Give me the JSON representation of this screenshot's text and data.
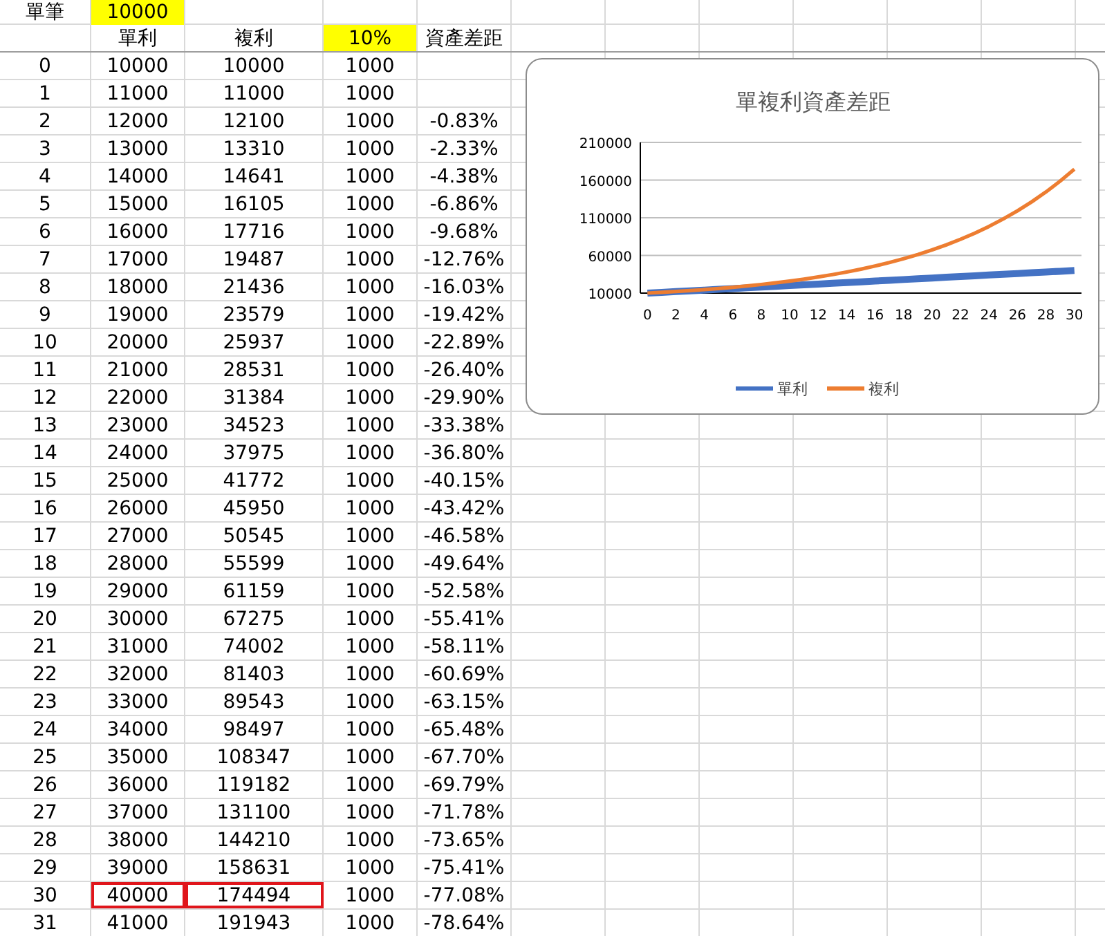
{
  "top": {
    "label": "單筆",
    "value": "10000"
  },
  "header": {
    "simple": "單利",
    "compound": "複利",
    "rate": "10%",
    "gap": "資產差距"
  },
  "rows": [
    {
      "n": "0",
      "simple": "10000",
      "compound": "10000",
      "rate": "1000",
      "outlined": false
    },
    {
      "n": "1",
      "simple": "11000",
      "compound": "11000",
      "rate": "1000",
      "outlined": false
    },
    {
      "n": "2",
      "simple": "12000",
      "compound": "12100",
      "rate": "1000",
      "gap": "-0.83%",
      "outlined": false
    },
    {
      "n": "3",
      "simple": "13000",
      "compound": "13310",
      "rate": "1000",
      "gap": "-2.33%",
      "outlined": false
    },
    {
      "n": "4",
      "simple": "14000",
      "compound": "14641",
      "rate": "1000",
      "gap": "-4.38%",
      "outlined": false
    },
    {
      "n": "5",
      "simple": "15000",
      "compound": "16105",
      "rate": "1000",
      "gap": "-6.86%",
      "outlined": false
    },
    {
      "n": "6",
      "simple": "16000",
      "compound": "17716",
      "rate": "1000",
      "gap": "-9.68%",
      "outlined": false
    },
    {
      "n": "7",
      "simple": "17000",
      "compound": "19487",
      "rate": "1000",
      "gap": "-12.76%",
      "outlined": false
    },
    {
      "n": "8",
      "simple": "18000",
      "compound": "21436",
      "rate": "1000",
      "gap": "-16.03%",
      "outlined": false
    },
    {
      "n": "9",
      "simple": "19000",
      "compound": "23579",
      "rate": "1000",
      "gap": "-19.42%",
      "outlined": false
    },
    {
      "n": "10",
      "simple": "20000",
      "compound": "25937",
      "rate": "1000",
      "gap": "-22.89%",
      "outlined": false
    },
    {
      "n": "11",
      "simple": "21000",
      "compound": "28531",
      "rate": "1000",
      "gap": "-26.40%",
      "outlined": false
    },
    {
      "n": "12",
      "simple": "22000",
      "compound": "31384",
      "rate": "1000",
      "gap": "-29.90%",
      "outlined": false
    },
    {
      "n": "13",
      "simple": "23000",
      "compound": "34523",
      "rate": "1000",
      "gap": "-33.38%",
      "outlined": false
    },
    {
      "n": "14",
      "simple": "24000",
      "compound": "37975",
      "rate": "1000",
      "gap": "-36.80%",
      "outlined": false
    },
    {
      "n": "15",
      "simple": "25000",
      "compound": "41772",
      "rate": "1000",
      "gap": "-40.15%",
      "outlined": false
    },
    {
      "n": "16",
      "simple": "26000",
      "compound": "45950",
      "rate": "1000",
      "gap": "-43.42%",
      "outlined": false
    },
    {
      "n": "17",
      "simple": "27000",
      "compound": "50545",
      "rate": "1000",
      "gap": "-46.58%",
      "outlined": false
    },
    {
      "n": "18",
      "simple": "28000",
      "compound": "55599",
      "rate": "1000",
      "gap": "-49.64%",
      "outlined": false
    },
    {
      "n": "19",
      "simple": "29000",
      "compound": "61159",
      "rate": "1000",
      "gap": "-52.58%",
      "outlined": false
    },
    {
      "n": "20",
      "simple": "30000",
      "compound": "67275",
      "rate": "1000",
      "gap": "-55.41%",
      "outlined": false
    },
    {
      "n": "21",
      "simple": "31000",
      "compound": "74002",
      "rate": "1000",
      "gap": "-58.11%",
      "outlined": false
    },
    {
      "n": "22",
      "simple": "32000",
      "compound": "81403",
      "rate": "1000",
      "gap": "-60.69%",
      "outlined": false
    },
    {
      "n": "23",
      "simple": "33000",
      "compound": "89543",
      "rate": "1000",
      "gap": "-63.15%",
      "outlined": false
    },
    {
      "n": "24",
      "simple": "34000",
      "compound": "98497",
      "rate": "1000",
      "gap": "-65.48%",
      "outlined": false
    },
    {
      "n": "25",
      "simple": "35000",
      "compound": "108347",
      "rate": "1000",
      "gap": "-67.70%",
      "outlined": false
    },
    {
      "n": "26",
      "simple": "36000",
      "compound": "119182",
      "rate": "1000",
      "gap": "-69.79%",
      "outlined": false
    },
    {
      "n": "27",
      "simple": "37000",
      "compound": "131100",
      "rate": "1000",
      "gap": "-71.78%",
      "outlined": false
    },
    {
      "n": "28",
      "simple": "38000",
      "compound": "144210",
      "rate": "1000",
      "gap": "-73.65%",
      "outlined": false
    },
    {
      "n": "29",
      "simple": "39000",
      "compound": "158631",
      "rate": "1000",
      "gap": "-75.41%",
      "outlined": false
    },
    {
      "n": "30",
      "simple": "40000",
      "compound": "174494",
      "rate": "1000",
      "gap": "-77.08%",
      "outlined": true
    },
    {
      "n": "31",
      "simple": "41000",
      "compound": "191943",
      "rate": "1000",
      "gap": "-78.64%",
      "outlined": false
    }
  ],
  "chart": {
    "chart_data": {
      "type": "line",
      "title": "單複利資產差距",
      "x": [
        0,
        1,
        2,
        3,
        4,
        5,
        6,
        7,
        8,
        9,
        10,
        11,
        12,
        13,
        14,
        15,
        16,
        17,
        18,
        19,
        20,
        21,
        22,
        23,
        24,
        25,
        26,
        27,
        28,
        29,
        30
      ],
      "series": [
        {
          "name": "單利",
          "color": "#4472c4",
          "values": [
            10000,
            11000,
            12000,
            13000,
            14000,
            15000,
            16000,
            17000,
            18000,
            19000,
            20000,
            21000,
            22000,
            23000,
            24000,
            25000,
            26000,
            27000,
            28000,
            29000,
            30000,
            31000,
            32000,
            33000,
            34000,
            35000,
            36000,
            37000,
            38000,
            39000,
            40000
          ]
        },
        {
          "name": "複利",
          "color": "#ed7d31",
          "values": [
            10000,
            11000,
            12100,
            13310,
            14641,
            16105,
            17716,
            19487,
            21436,
            23579,
            25937,
            28531,
            31384,
            34523,
            37975,
            41772,
            45950,
            50545,
            55599,
            61159,
            67275,
            74002,
            81403,
            89543,
            98497,
            108347,
            119182,
            131100,
            144210,
            158631,
            174494
          ]
        }
      ],
      "xlim": [
        -0.5,
        30.5
      ],
      "grid": true,
      "legend": "bottom",
      "ylim": [
        10000,
        210000
      ],
      "yticks": [
        10000,
        60000,
        110000,
        160000,
        210000
      ],
      "xticks": [
        0,
        2,
        4,
        6,
        8,
        10,
        12,
        14,
        16,
        18,
        20,
        22,
        24,
        26,
        28,
        30
      ]
    }
  }
}
